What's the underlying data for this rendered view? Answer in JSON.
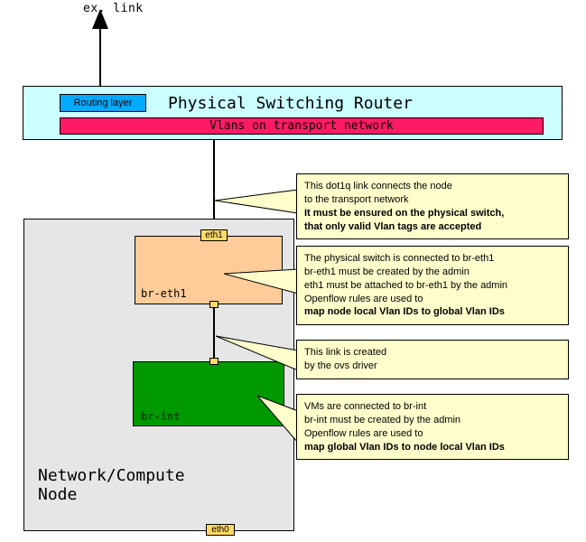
{
  "top_label": "ex. link",
  "router": {
    "title": "Physical Switching Router",
    "routing_layer": "Routing layer",
    "vlan_bar": "Vlans on transport network"
  },
  "node": {
    "title": "Network/Compute\nNode",
    "bridge1_label": "br-eth1",
    "bridge2_label": "br-int",
    "port_eth1": "eth1",
    "port_eth0": "eth0"
  },
  "callouts": {
    "c1": {
      "line1": "This dot1q link connects the node",
      "line2": "to the transport network",
      "bold1": "It must be ensured on the physical switch,",
      "bold2": "that only valid Vlan tags are accepted"
    },
    "c2": {
      "line1": "The physical switch is connected to br-eth1",
      "line2": "br-eth1 must be created by the admin",
      "line3": "eth1 must be attached to br-eth1 by the admin",
      "line4": "Openflow rules are used to",
      "bold1": "map node local Vlan IDs to global Vlan IDs"
    },
    "c3": {
      "line1": "This link is created",
      "line2": "by the ovs driver"
    },
    "c4": {
      "line1": "VMs are connected to br-int",
      "line2": "br-int must be created by the admin",
      "line3": "Openflow rules are used to",
      "bold1": "map global Vlan IDs to node local Vlan IDs"
    }
  },
  "colors": {
    "router_bg": "#ccffff",
    "routing_layer_bg": "#00aaff",
    "vlan_bar_bg": "#ff1a66",
    "node_bg": "#e6e6e6",
    "bridge1_bg": "#ffcc99",
    "bridge2_bg": "#009900",
    "port_bg": "#ffd966",
    "callout_bg": "#ffffcc"
  }
}
